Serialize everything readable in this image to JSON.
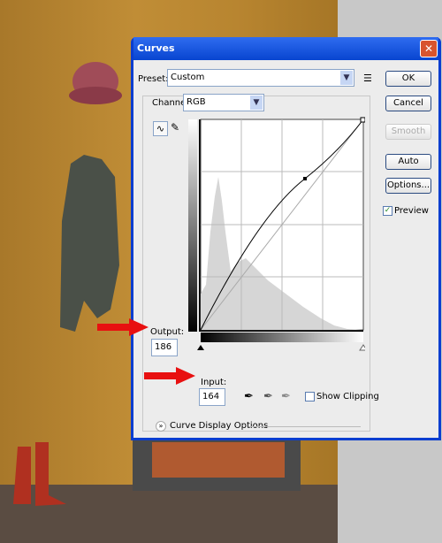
{
  "dialog": {
    "title": "Curves",
    "close_icon": "close-icon",
    "preset_label": "Preset:",
    "preset_value": "Custom",
    "channel_label": "Channel:",
    "channel_value": "RGB",
    "buttons": {
      "ok": "OK",
      "cancel": "Cancel",
      "smooth": "Smooth",
      "auto": "Auto",
      "options": "Options..."
    },
    "preview_label": "Preview",
    "preview_checked": true,
    "output_label": "Output:",
    "output_value": "186",
    "input_label": "Input:",
    "input_value": "164",
    "show_clipping_label": "Show Clipping",
    "show_clipping_checked": false,
    "curve_display_options": "Curve Display Options",
    "curve_point": {
      "input": 164,
      "output": 186
    }
  },
  "colors": {
    "titlebar": "#0845d0",
    "arrow": "#e81010",
    "wall": "#b88530"
  }
}
